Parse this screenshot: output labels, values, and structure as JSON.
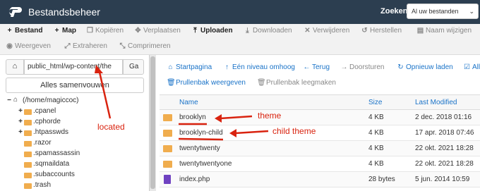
{
  "app": {
    "title": "Bestandsbeheer"
  },
  "search": {
    "label": "Zoeken",
    "scope": "Al uw bestanden"
  },
  "toolbar": {
    "row1": [
      {
        "label": "Bestand",
        "icon": "plus-icon",
        "enabled": true
      },
      {
        "label": "Map",
        "icon": "plus-icon",
        "enabled": true
      },
      {
        "label": "Kopiëren",
        "icon": "copy-icon",
        "enabled": false
      },
      {
        "label": "Verplaatsen",
        "icon": "move-icon",
        "enabled": false
      },
      {
        "label": "Uploaden",
        "icon": "upload-icon",
        "enabled": true
      },
      {
        "label": "Downloaden",
        "icon": "download-icon",
        "enabled": false
      },
      {
        "label": "Verwijderen",
        "icon": "delete-icon",
        "enabled": false
      },
      {
        "label": "Herstellen",
        "icon": "restore-icon",
        "enabled": false
      },
      {
        "label": "Naam wijzigen",
        "icon": "rename-icon",
        "enabled": false
      }
    ],
    "row2": [
      {
        "label": "Weergeven",
        "icon": "eye-icon",
        "enabled": false
      },
      {
        "label": "Extraheren",
        "icon": "extract-icon",
        "enabled": false
      },
      {
        "label": "Comprimeren",
        "icon": "compress-icon",
        "enabled": false
      }
    ]
  },
  "sidebar": {
    "path_value": "public_html/wp-content/the",
    "go_label": "Ga",
    "collapse_label": "Alles samenvouwen",
    "root_label": "(/home/magiccoc)",
    "tree": [
      {
        "label": ".cpanel",
        "expandable": true
      },
      {
        "label": ".cphorde",
        "expandable": true
      },
      {
        "label": ".htpasswds",
        "expandable": true
      },
      {
        "label": ".razor",
        "expandable": false
      },
      {
        "label": ".spamassassin",
        "expandable": false
      },
      {
        "label": ".sqmaildata",
        "expandable": false
      },
      {
        "label": ".subaccounts",
        "expandable": false
      },
      {
        "label": ".trash",
        "expandable": false
      }
    ]
  },
  "actions": {
    "row1": [
      {
        "label": "Startpagina",
        "icon": "home-icon",
        "enabled": true
      },
      {
        "label": "Eén niveau omhoog",
        "icon": "level-up-icon",
        "enabled": true
      },
      {
        "label": "Terug",
        "icon": "arrow-left-icon",
        "enabled": true
      },
      {
        "label": "Doorsturen",
        "icon": "arrow-right-icon",
        "enabled": false
      },
      {
        "label": "Opnieuw laden",
        "icon": "reload-icon",
        "enabled": true
      },
      {
        "label": "All",
        "icon": "checkbox-icon",
        "enabled": true
      }
    ],
    "row2": [
      {
        "label": "Prullenbak weergeven",
        "icon": "trash-icon",
        "enabled": true
      },
      {
        "label": "Prullenbak leegmaken",
        "icon": "trash-icon",
        "enabled": false
      }
    ]
  },
  "table": {
    "headers": {
      "name": "Name",
      "size": "Size",
      "modified": "Last Modified"
    },
    "rows": [
      {
        "type": "folder",
        "name": "brooklyn",
        "size": "4 KB",
        "modified": "2 dec. 2018 01:16"
      },
      {
        "type": "folder",
        "name": "brooklyn-child",
        "size": "4 KB",
        "modified": "17 apr. 2018 07:46"
      },
      {
        "type": "folder",
        "name": "twentytwenty",
        "size": "4 KB",
        "modified": "22 okt. 2021 18:28"
      },
      {
        "type": "folder",
        "name": "twentytwentyone",
        "size": "4 KB",
        "modified": "22 okt. 2021 18:28"
      },
      {
        "type": "file",
        "name": "index.php",
        "size": "28 bytes",
        "modified": "5 jun. 2014 10:59"
      }
    ]
  },
  "annotations": {
    "located": "located",
    "theme": "theme",
    "child_theme": "child theme"
  },
  "colors": {
    "header_bg": "#2c3e50",
    "link": "#1a73c8",
    "folder": "#f0ad4e",
    "annotation": "#d9230f"
  }
}
